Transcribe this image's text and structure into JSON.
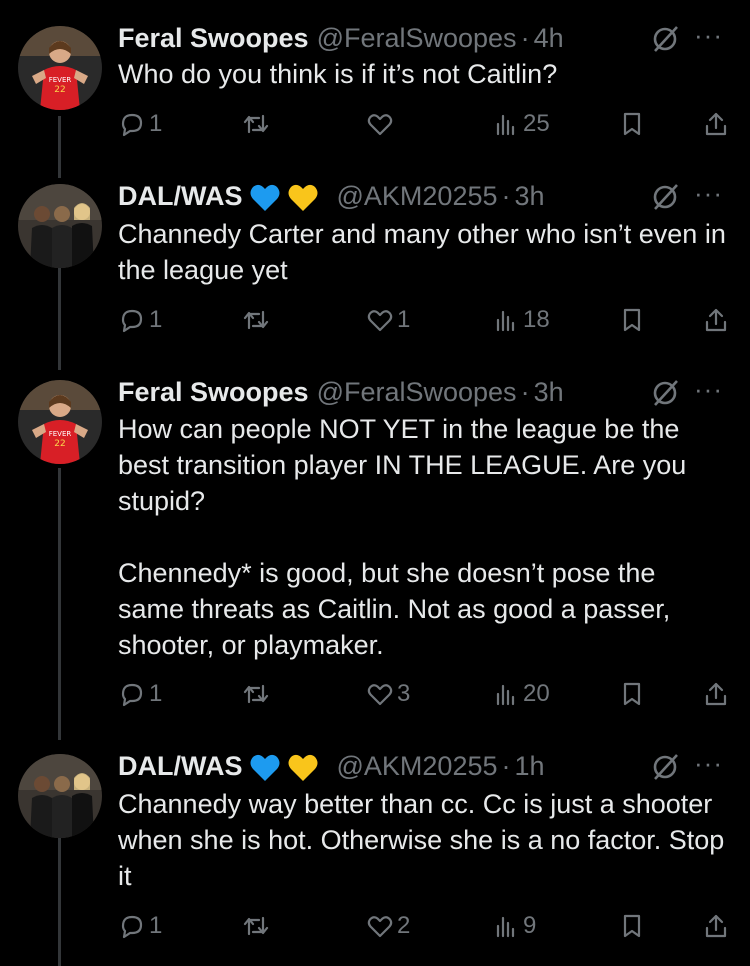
{
  "tweets": [
    {
      "name": "Feral Swoopes",
      "handle": "@FeralSwoopes",
      "time": "4h",
      "text": "Who do you think is if it’s not Caitlin?",
      "replies": "1",
      "retweets": "",
      "likes": "",
      "views": "25",
      "avatar": "fever-player-avatar",
      "badges": []
    },
    {
      "name": "DAL/WAS",
      "handle": "@AKM20255",
      "time": "3h",
      "text": "Channedy Carter and many other who isn’t even in the league yet",
      "replies": "1",
      "retweets": "",
      "likes": "1",
      "views": "18",
      "avatar": "group-photo-avatar",
      "badges": [
        "blue-heart",
        "yellow-heart"
      ]
    },
    {
      "name": "Feral Swoopes",
      "handle": "@FeralSwoopes",
      "time": "3h",
      "text": "How can people NOT YET in the league be the best transition player IN THE LEAGUE. Are you stupid?\n\nChennedy* is good, but she doesn’t pose the same threats as Caitlin. Not as good a passer, shooter, or playmaker.",
      "replies": "1",
      "retweets": "",
      "likes": "3",
      "views": "20",
      "avatar": "fever-player-avatar",
      "badges": []
    },
    {
      "name": "DAL/WAS",
      "handle": "@AKM20255",
      "time": "1h",
      "text": "Channedy way better than cc. Cc is just a shooter when she is hot. Otherwise she is a no factor. Stop it",
      "replies": "1",
      "retweets": "",
      "likes": "2",
      "views": "9",
      "avatar": "group-photo-avatar",
      "badges": [
        "blue-heart",
        "yellow-heart"
      ]
    }
  ],
  "colors": {
    "background": "#000000",
    "text": "#e7e9ea",
    "muted": "#71767b",
    "thread_line": "#333639",
    "blue_heart": "#1d9bf0",
    "yellow_heart": "#f9c51b"
  }
}
